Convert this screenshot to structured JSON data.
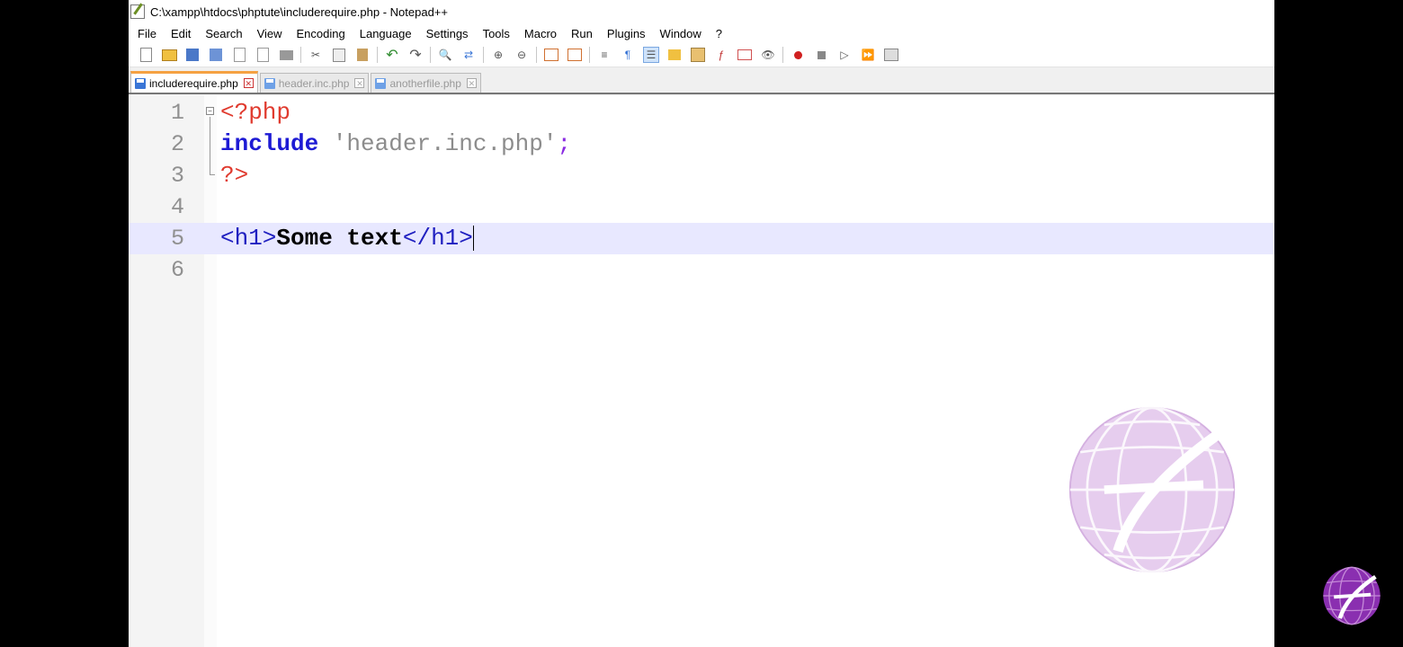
{
  "window": {
    "title": "C:\\xampp\\htdocs\\phptute\\includerequire.php - Notepad++"
  },
  "menu": [
    "File",
    "Edit",
    "Search",
    "View",
    "Encoding",
    "Language",
    "Settings",
    "Tools",
    "Macro",
    "Run",
    "Plugins",
    "Window",
    "?"
  ],
  "tabs": [
    {
      "label": "includerequire.php",
      "active": true
    },
    {
      "label": "header.inc.php",
      "active": false
    },
    {
      "label": "anotherfile.php",
      "active": false
    }
  ],
  "editor": {
    "line_numbers": [
      "1",
      "2",
      "3",
      "4",
      "5",
      "6"
    ],
    "code": {
      "php_open": "<?php",
      "include_kw": "include",
      "include_str": "'header.inc.php'",
      "semicolon": ";",
      "php_close": "?>",
      "h1_open": "<h1>",
      "h1_text": "Some text",
      "h1_close": "</h1>"
    },
    "current_line": "5"
  },
  "colors": {
    "php_tag": "#e03b2f",
    "keyword": "#1d1ad4",
    "string": "#8c8c8c",
    "html_tag": "#2020c0",
    "current_line_bg": "#e8e8ff",
    "watermark": "#8a2fb0"
  }
}
